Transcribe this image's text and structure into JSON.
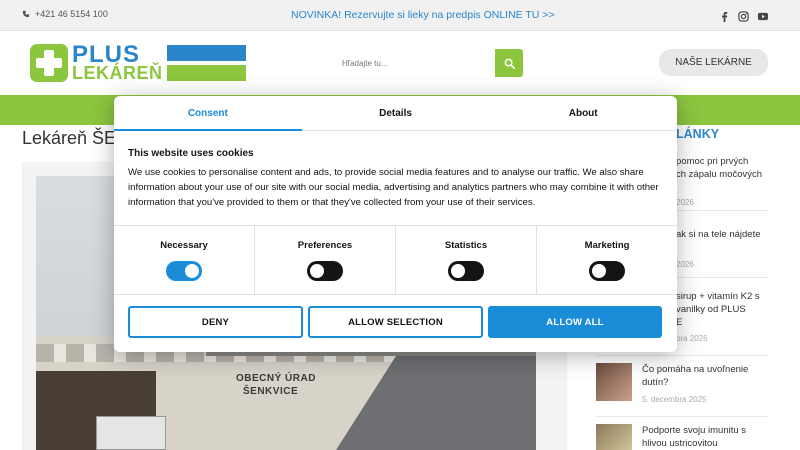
{
  "topbar": {
    "phone": "+421 46 5154 100",
    "promo": "NOVINKA! Rezervujte si lieky na predpis ONLINE TU >>",
    "social_icons": [
      "facebook-icon",
      "instagram-icon",
      "youtube-icon"
    ]
  },
  "header": {
    "logo_line1": "PLUS",
    "logo_line2": "LEKÁREŇ",
    "search_placeholder": "Hľadajte tu...",
    "nav_button": "NAŠE LEKÁRNE"
  },
  "page": {
    "title_visible": "Lekáreň ŠE",
    "photo_sign_line1": "OBECNÝ ÚRAD",
    "photo_sign_line2": "ŠENKVICE",
    "sidebar_title": "LÁNKY",
    "sidebar_items": [
      {
        "text": "pomoc pri prvých\nch zápalu močových",
        "date": "2026"
      },
      {
        "text": "ak si na tele nájdete",
        "date": "2026"
      },
      {
        "text": "sirup + vitamín K2 s\nvanilky od PLUS\nE",
        "date": "bra 2026"
      },
      {
        "text": "Čo pomáha na uvoľnenie\ndutín?",
        "date": "5. decembra 2025"
      },
      {
        "text": "Podporte svoju imunitu s\nhlivou ustricovitou",
        "date": ""
      }
    ]
  },
  "cookie_modal": {
    "tabs": [
      "Consent",
      "Details",
      "About"
    ],
    "active_tab": "Consent",
    "heading": "This website uses cookies",
    "body": "We use cookies to personalise content and ads, to provide social media features and to analyse our traffic. We also share information about your use of our site with our social media, advertising and analytics partners who may combine it with other information that you've provided to them or that they've collected from your use of their services.",
    "toggles": [
      {
        "label": "Necessary",
        "on": true
      },
      {
        "label": "Preferences",
        "on": false
      },
      {
        "label": "Statistics",
        "on": false
      },
      {
        "label": "Marketing",
        "on": false
      }
    ],
    "buttons": {
      "deny": "DENY",
      "allow_selection": "ALLOW SELECTION",
      "allow_all": "ALLOW ALL"
    }
  },
  "colors": {
    "brand_blue": "#2a86c9",
    "brand_green": "#8cc63f",
    "cookie_accent": "#1a8cd8"
  }
}
